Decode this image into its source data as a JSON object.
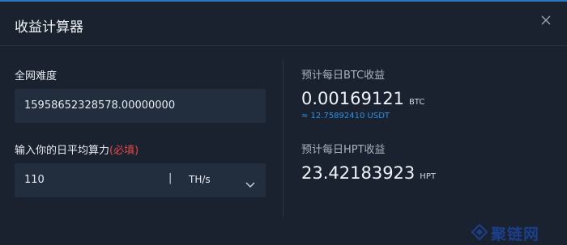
{
  "dialog": {
    "title": "收益计算器"
  },
  "left": {
    "difficulty_label": "全网难度",
    "difficulty_value": "15958652328578.00000000",
    "hashrate_label": "输入你的日平均算力",
    "hashrate_required": "(必填)",
    "hashrate_value": "110",
    "separator": "|",
    "unit": "TH/s"
  },
  "right": {
    "btc_label": "预计每日BTC收益",
    "btc_value": "0.00169121",
    "btc_unit": "BTC",
    "btc_usdt": "≈ 12.75892410 USDT",
    "hpt_label": "预计每日HPT收益",
    "hpt_value": "23.42183923",
    "hpt_unit": "HPT"
  },
  "watermark": {
    "text": "聚链网"
  },
  "colors": {
    "background": "#1a2230",
    "field": "#222d3e",
    "accent": "#2f74c0",
    "required": "#e04848",
    "usdt": "#2f8fe0"
  }
}
